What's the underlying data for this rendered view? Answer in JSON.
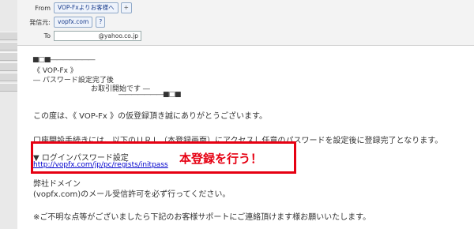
{
  "header": {
    "from_label": "From",
    "from_value": "VOP-Fxよりお客様へ",
    "from_add": "+",
    "sender_label": "発信元:",
    "sender_value": "vopfx.com",
    "sender_help": "?",
    "to_label": "To",
    "to_value": "@yahoo.co.jp"
  },
  "email": {
    "banner_line1": "■□■―――――――",
    "banner_line2": "《 VOP-Fx 》",
    "banner_line3": "― パスワード設定完了後",
    "banner_line4": "お取引開始です ―",
    "banner_line5": "―――――――■□■",
    "para1": "この度は、《 VOP-Fx 》の仮登録頂き誠にありがとうございます。",
    "para2": "口座開設手続きには、以下のＵＲＬ（本登録画面）にアクセスし任意のパスワードを設定後に登録完了となります。",
    "login_heading": "▼ ログインパスワード設定",
    "login_url": "http://vopfx.com/jp/pc/regists/initpass",
    "annotation": "本登録を行う！",
    "domain_heading": "弊社ドメイン",
    "domain_note": "(vopfx.com)のメール受信許可を必ず行ってください。",
    "support_note": "※ご不明な点等がございましたら下記のお客様サポートにご連絡頂けます様お願いいたします。"
  },
  "colors": {
    "annotation_red": "#e60012",
    "link_blue": "#0000cc"
  }
}
